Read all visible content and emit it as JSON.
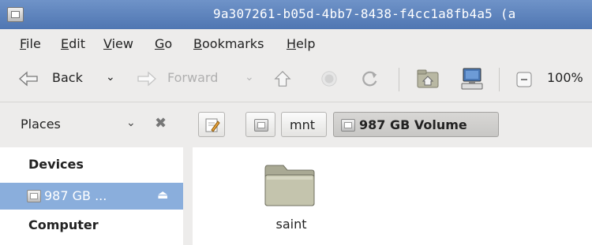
{
  "window": {
    "title": "9a307261-b05d-4bb7-8438-f4cc1a8fb4a5 (a"
  },
  "menu": {
    "items": [
      {
        "pre": "",
        "acc": "F",
        "post": "ile"
      },
      {
        "pre": "",
        "acc": "E",
        "post": "dit"
      },
      {
        "pre": "",
        "acc": "V",
        "post": "iew"
      },
      {
        "pre": "",
        "acc": "G",
        "post": "o"
      },
      {
        "pre": "",
        "acc": "B",
        "post": "ookmarks"
      },
      {
        "pre": "",
        "acc": "H",
        "post": "elp"
      }
    ]
  },
  "toolbar": {
    "back_label": "Back",
    "forward_label": "Forward",
    "zoom": "100%"
  },
  "location": {
    "places_label": "Places",
    "crumbs": [
      "mnt",
      "987 GB Volume"
    ]
  },
  "sidebar": {
    "devices_heading": "Devices",
    "device_label": "987 GB ...",
    "computer_heading": "Computer"
  },
  "files": [
    {
      "name": "saint",
      "type": "folder"
    }
  ],
  "colors": {
    "titlebar": "#5b80bb",
    "selection": "#8aaedc"
  }
}
